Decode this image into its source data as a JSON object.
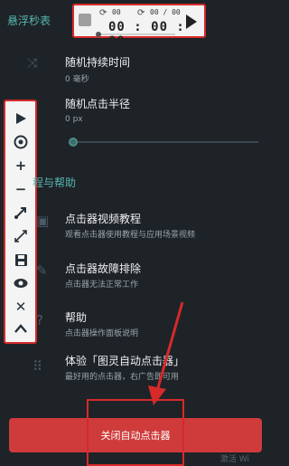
{
  "colors": {
    "background": "#1e2328",
    "accent": "#57b8b0",
    "highlight": "#d62a2a",
    "button": "#cf3b3b"
  },
  "header": {
    "section_title": "悬浮秒表"
  },
  "timer": {
    "loop_count": "00",
    "loop_limit": "00 / 00",
    "time": "00 : 00 : 00",
    "play_icon": "play-icon",
    "stop_icon": "stop-icon"
  },
  "settings": {
    "random_duration": {
      "title": "随机持续时间",
      "value": "0 毫秒"
    },
    "random_radius": {
      "title": "随机点击半径",
      "value": "0 px",
      "slider_fraction": 0
    }
  },
  "toolbar": {
    "icons": [
      "play-icon",
      "target-icon",
      "plus-icon",
      "minus-icon",
      "swipe-icon",
      "shrink-icon",
      "save-icon",
      "eye-icon",
      "close-icon",
      "chevron-up-icon"
    ]
  },
  "help": {
    "section_title": "程与帮助",
    "items": [
      {
        "title": "点击器视频教程",
        "subtitle": "观看点击器使用教程与应用场景视频"
      },
      {
        "title": "点击器故障排除",
        "subtitle": "点击器无法正常工作"
      },
      {
        "title": "帮助",
        "subtitle": "点击器操作面板说明"
      },
      {
        "title": "体验「图灵自动点击器」",
        "subtitle": "最好用的点击器，右广告即可用"
      }
    ]
  },
  "footer": {
    "close_button": "关闭自动点击器",
    "watermark": "激活 Wi"
  }
}
